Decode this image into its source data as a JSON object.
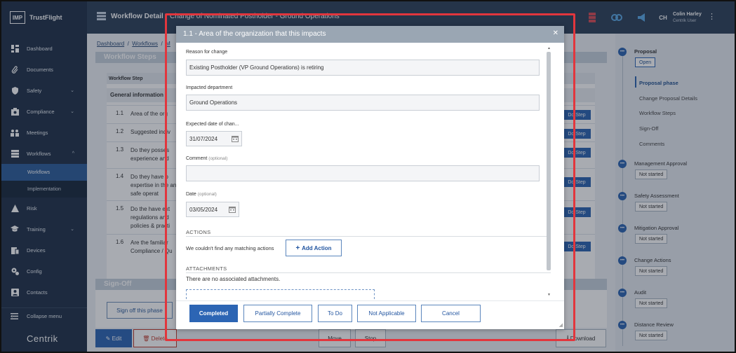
{
  "app": {
    "brand": "TrustFlight",
    "logo_text": "IMP",
    "footer_brand": "Centrik"
  },
  "sidebar": {
    "items": [
      {
        "label": "Dashboard",
        "icon": "dashboard-icon"
      },
      {
        "label": "Documents",
        "icon": "paperclip-icon"
      },
      {
        "label": "Safety",
        "icon": "shield-icon",
        "chevron": "⌄"
      },
      {
        "label": "Compliance",
        "icon": "compliance-icon",
        "chevron": "⌄"
      },
      {
        "label": "Meetings",
        "icon": "meetings-icon"
      },
      {
        "label": "Workflows",
        "icon": "workflows-icon",
        "chevron": "^"
      },
      {
        "label": "Risk",
        "icon": "risk-icon"
      },
      {
        "label": "Training",
        "icon": "graduation-cap-icon",
        "chevron": "⌄"
      },
      {
        "label": "Devices",
        "icon": "devices-icon"
      },
      {
        "label": "Config",
        "icon": "config-icon"
      },
      {
        "label": "Contacts",
        "icon": "contacts-icon"
      }
    ],
    "sub_items": [
      {
        "label": "Workflows",
        "active": true
      },
      {
        "label": "Implementation",
        "active": false
      }
    ],
    "collapse_label": "Collapse menu"
  },
  "header": {
    "title": "Workflow Detail",
    "subtitle": "Change of Nominated Postholder - Ground Operations",
    "user": {
      "initials": "CH",
      "name": "Colin Harley",
      "role": "Centrik User"
    }
  },
  "main": {
    "breadcrumb": [
      "Dashboard",
      "Workflows",
      "M"
    ],
    "workflow_steps_title": "Workflow Steps",
    "table_header": "Workflow Step",
    "group_label": "General information",
    "rows": [
      {
        "num": "1.1",
        "text": "Area of the org"
      },
      {
        "num": "1.2",
        "text": "Suggested indiv"
      },
      {
        "num": "1.3",
        "text": "Do they posses experience and"
      },
      {
        "num": "1.4",
        "text": "Do they have p expertise in the and safe operat"
      },
      {
        "num": "1.5",
        "text": "Do the have ext regulations and policies & practi"
      },
      {
        "num": "1.6",
        "text": "Are the familiar Compliance / Qu"
      }
    ],
    "do_step_label": "Do Step",
    "signoff_title": "Sign-Off",
    "signoff_button": "Sign off this phase",
    "bottom_buttons": {
      "edit": "Edit",
      "delete": "Delete",
      "move": "Move",
      "stop": "Stop",
      "download": "Download"
    }
  },
  "rail": {
    "stages": [
      {
        "label": "Proposal",
        "status": "Open"
      },
      {
        "label": "Management Approval",
        "status": "Not started"
      },
      {
        "label": "Safety Assessment",
        "status": "Not started"
      },
      {
        "label": "Mitigation Approval",
        "status": "Not started"
      },
      {
        "label": "Change Actions",
        "status": "Not started"
      },
      {
        "label": "Audit",
        "status": "Not started"
      },
      {
        "label": "Distance Review",
        "status": "Not started"
      }
    ],
    "phases": [
      "Proposal phase",
      "Change Proposal Details",
      "Workflow Steps",
      "Sign-Off",
      "Comments"
    ]
  },
  "modal": {
    "title": "1.1 - Area of the organization that this impacts",
    "fields": {
      "reason_label": "Reason for change",
      "reason_value": "Existing Postholder (VP Ground Operations) is retiring",
      "dept_label": "Impacted department",
      "dept_value": "Ground Operations",
      "expected_label": "Expected date of chan...",
      "expected_value": "31/07/2024",
      "comment_label": "Comment",
      "comment_optional": "(optional)",
      "comment_value": "",
      "date_label": "Date",
      "date_optional": "(optional)",
      "date_value": "03/05/2024"
    },
    "actions_title": "ACTIONS",
    "no_actions_text": "We couldn't find any matching actions",
    "add_action_label": "Add Action",
    "attachments_title": "ATTACHMENTS",
    "no_attachments_text": "There are no associated attachments.",
    "footer_buttons": {
      "completed": "Completed",
      "partially_complete": "Partially Complete",
      "to_do": "To Do",
      "not_applicable": "Not Applicable",
      "cancel": "Cancel"
    }
  },
  "colors": {
    "accent": "#2c65b4",
    "highlight": "#e2363d",
    "sidebar": "#1f3047",
    "header": "#2d3f58"
  }
}
